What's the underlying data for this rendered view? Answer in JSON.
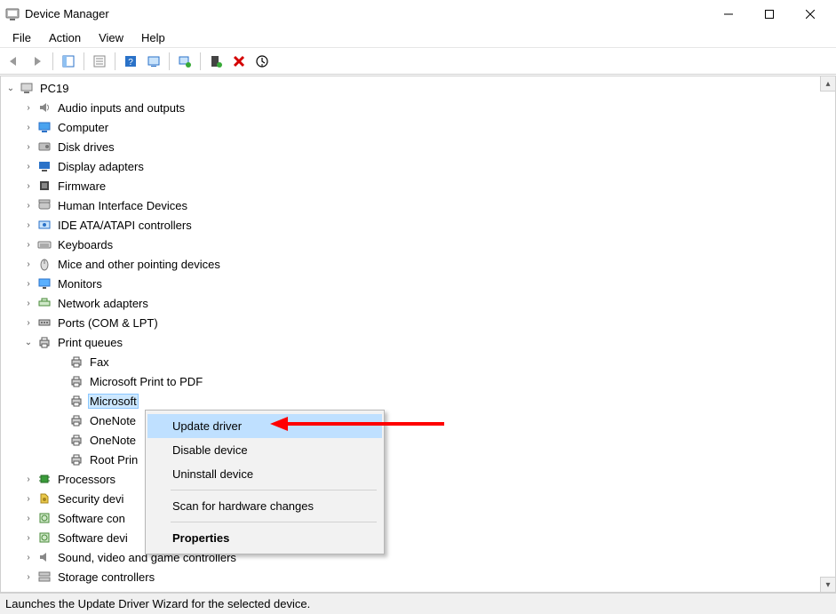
{
  "window": {
    "title": "Device Manager"
  },
  "menu": {
    "items": [
      "File",
      "Action",
      "View",
      "Help"
    ]
  },
  "tree": {
    "root": "PC19",
    "categories": [
      {
        "icon": "audio",
        "label": "Audio inputs and outputs",
        "expanded": false
      },
      {
        "icon": "computer",
        "label": "Computer",
        "expanded": false
      },
      {
        "icon": "disk",
        "label": "Disk drives",
        "expanded": false
      },
      {
        "icon": "display",
        "label": "Display adapters",
        "expanded": false
      },
      {
        "icon": "firmware",
        "label": "Firmware",
        "expanded": false
      },
      {
        "icon": "hid",
        "label": "Human Interface Devices",
        "expanded": false
      },
      {
        "icon": "ide",
        "label": "IDE ATA/ATAPI controllers",
        "expanded": false
      },
      {
        "icon": "keyboard",
        "label": "Keyboards",
        "expanded": false
      },
      {
        "icon": "mouse",
        "label": "Mice and other pointing devices",
        "expanded": false
      },
      {
        "icon": "monitor",
        "label": "Monitors",
        "expanded": false
      },
      {
        "icon": "network",
        "label": "Network adapters",
        "expanded": false
      },
      {
        "icon": "port",
        "label": "Ports (COM & LPT)",
        "expanded": false
      },
      {
        "icon": "printer",
        "label": "Print queues",
        "expanded": true,
        "children": [
          {
            "icon": "printer",
            "label": "Fax"
          },
          {
            "icon": "printer",
            "label": "Microsoft Print to PDF"
          },
          {
            "icon": "printer",
            "label": "Microsoft XPS Document Writer",
            "selected": true,
            "truncated": "Microsoft "
          },
          {
            "icon": "printer",
            "label": "OneNote",
            "truncated": "OneNote"
          },
          {
            "icon": "printer",
            "label": "OneNote",
            "truncated": "OneNote"
          },
          {
            "icon": "printer",
            "label": "Root Print Queue",
            "truncated": "Root Prin"
          }
        ]
      },
      {
        "icon": "cpu",
        "label": "Processors",
        "expanded": false
      },
      {
        "icon": "security",
        "label": "Security devices",
        "expanded": false,
        "truncated": "Security devi"
      },
      {
        "icon": "software",
        "label": "Software components",
        "expanded": false,
        "truncated": "Software con"
      },
      {
        "icon": "software",
        "label": "Software devices",
        "expanded": false,
        "truncated": "Software devi"
      },
      {
        "icon": "sound",
        "label": "Sound, video and game controllers",
        "expanded": false
      },
      {
        "icon": "storage",
        "label": "Storage controllers",
        "expanded": false,
        "truncated": "Storage controllers"
      }
    ]
  },
  "context_menu": {
    "items": [
      {
        "label": "Update driver",
        "hover": true
      },
      {
        "label": "Disable device"
      },
      {
        "label": "Uninstall device"
      },
      {
        "sep": true
      },
      {
        "label": "Scan for hardware changes"
      },
      {
        "sep": true
      },
      {
        "label": "Properties",
        "bold": true
      }
    ]
  },
  "statusbar": {
    "text": "Launches the Update Driver Wizard for the selected device."
  }
}
